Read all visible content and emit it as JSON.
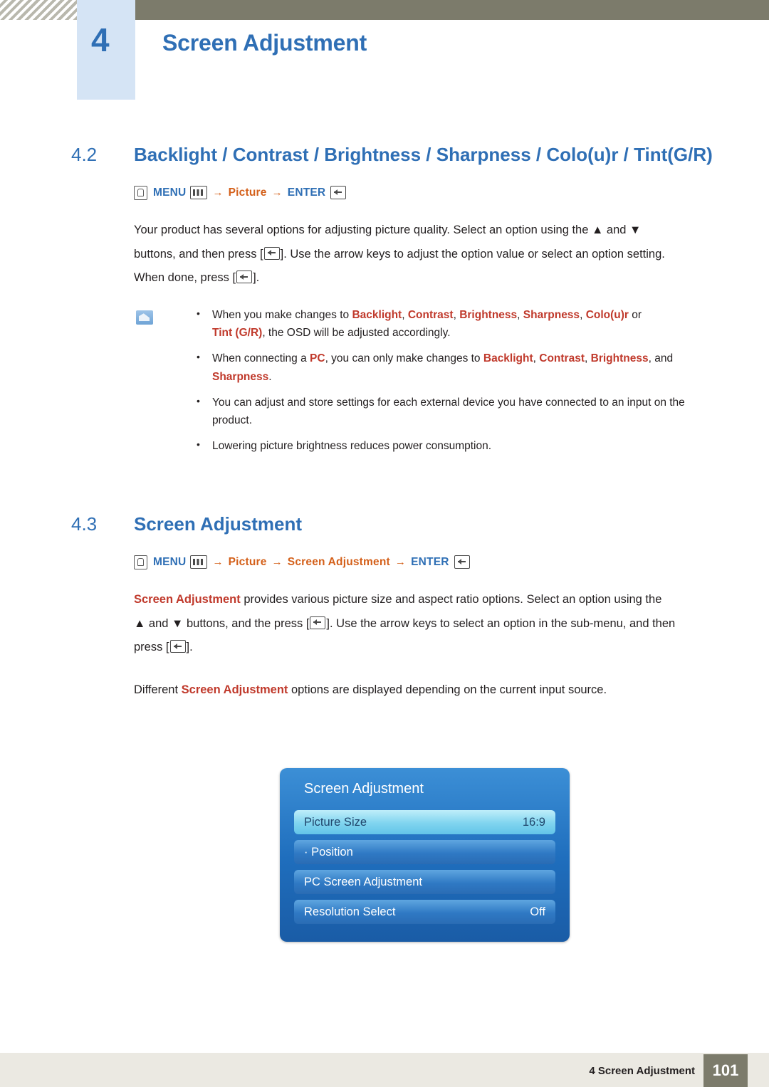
{
  "header": {
    "chapter_number": "4",
    "chapter_title": "Screen Adjustment"
  },
  "section_42": {
    "number": "4.2",
    "title": "Backlight / Contrast / Brightness / Sharpness / Colo(u)r / Tint(G/R)",
    "menu_path": {
      "hand_icon": "hand-press-icon",
      "menu_label": "MENU",
      "menu_icon": "menu-grid-icon",
      "arrow1": "→",
      "picture_label": "Picture",
      "arrow2": "→",
      "enter_label": "ENTER",
      "enter_icon": "enter-key-icon"
    },
    "paragraph_1_a": "Your product has several options for adjusting picture quality. Select an option using the ",
    "paragraph_1_up": "▲",
    "paragraph_1_b": " and ",
    "paragraph_1_down": "▼",
    "paragraph_1_c": "buttons, and then press [",
    "paragraph_1_d": "]. Use the arrow keys to adjust the option value or select an option setting.",
    "paragraph_1_e": "When done, press [",
    "paragraph_1_f": "].",
    "notes": [
      {
        "pre": "When you make changes to ",
        "terms": [
          "Backlight",
          "Contrast",
          "Brightness",
          "Sharpness",
          "Colo(u)r"
        ],
        "mid": " or ",
        "term_last": "Tint (G/R)",
        "post": ", the OSD will be adjusted accordingly."
      },
      {
        "pre": "When connecting a ",
        "pc": "PC",
        "mid": ", you can only make changes to ",
        "terms": [
          "Backlight",
          "Contrast",
          "Brightness"
        ],
        "and": ", and ",
        "term_last": "Sharpness",
        "post": "."
      },
      {
        "text": "You can adjust and store settings for each external device you have connected to an input on the product."
      },
      {
        "text": "Lowering picture brightness reduces power consumption."
      }
    ]
  },
  "section_43": {
    "number": "4.3",
    "title": "Screen Adjustment",
    "menu_path": {
      "hand_icon": "hand-press-icon",
      "menu_label": "MENU",
      "menu_icon": "menu-grid-icon",
      "arrow1": "→",
      "picture_label": "Picture",
      "arrow2": "→",
      "screen_adjustment_label": "Screen Adjustment",
      "arrow3": "→",
      "enter_label": "ENTER",
      "enter_icon": "enter-key-icon"
    },
    "paragraph_1_term": "Screen Adjustment",
    "paragraph_1_a": " provides various picture size and aspect ratio options. Select an option using the ",
    "paragraph_1_up": "▲",
    "paragraph_1_b": " and ",
    "paragraph_1_down": "▼",
    "paragraph_1_c": " buttons, and the press [",
    "paragraph_1_d": "]. Use the arrow keys to select an option in the sub-menu, and then",
    "paragraph_1_e": "press [",
    "paragraph_1_f": "].",
    "paragraph_2_a": "Different ",
    "paragraph_2_term": "Screen Adjustment",
    "paragraph_2_b": " options are displayed depending on the current input source."
  },
  "osd": {
    "title": "Screen Adjustment",
    "rows": [
      {
        "label": "Picture Size",
        "value": "16:9",
        "selected": true
      },
      {
        "label": "· Position",
        "value": "",
        "selected": false
      },
      {
        "label": "PC Screen Adjustment",
        "value": "",
        "selected": false
      },
      {
        "label": "Resolution Select",
        "value": "Off",
        "selected": false
      }
    ]
  },
  "footer": {
    "text": "4 Screen Adjustment",
    "page": "101"
  },
  "colors": {
    "brand_blue": "#2f6fb5",
    "accent_orange": "#d4601a",
    "highlight_red": "#c0392b",
    "header_band": "#7c7b6b",
    "badge_bg": "#d5e4f5"
  }
}
